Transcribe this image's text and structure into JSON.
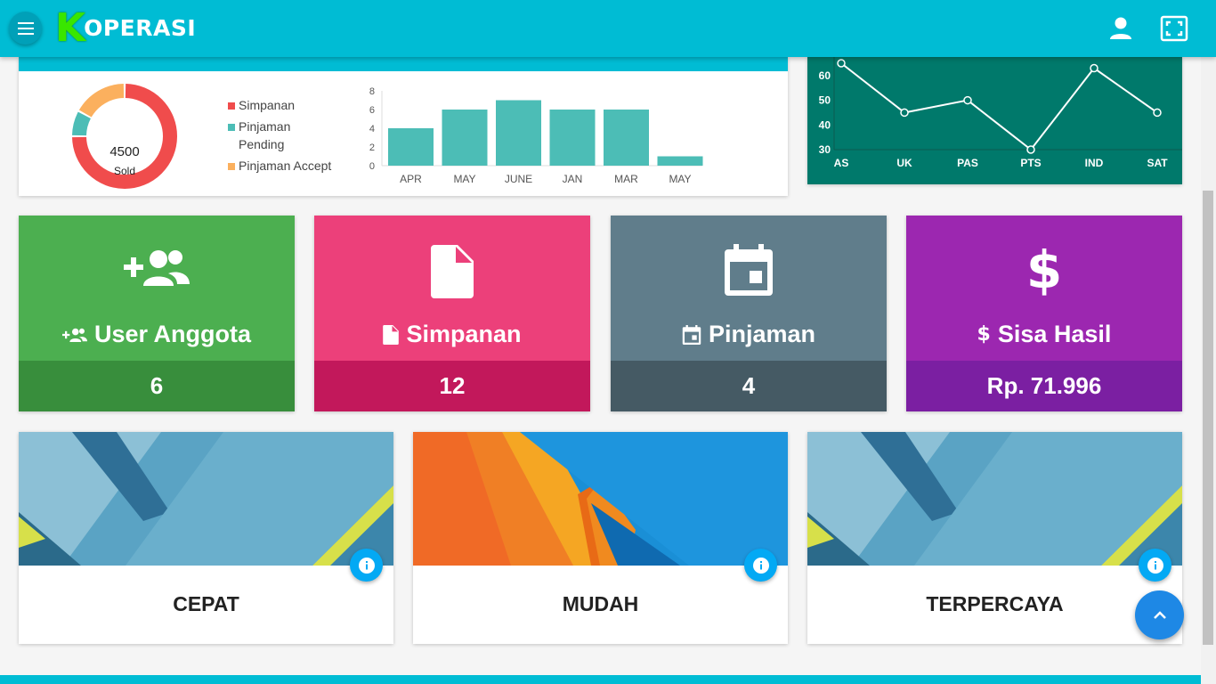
{
  "header": {
    "logo_initial": "K",
    "logo_rest": "OPERASI",
    "menu_icon": "menu-icon",
    "user_icon": "account-icon",
    "fullscreen_icon": "fullscreen-icon"
  },
  "donut": {
    "center_value": "4500",
    "center_label": "Sold"
  },
  "legend": [
    {
      "label": "Simpanan",
      "color": "#f04c4c"
    },
    {
      "label": "Pinjaman Pending",
      "color": "#4cbdb6"
    },
    {
      "label": "Pinjaman Accept",
      "color": "#fbb05e"
    }
  ],
  "chart_data": [
    {
      "type": "pie",
      "categories": [
        "Simpanan",
        "Pinjaman Pending",
        "Pinjaman Accept"
      ],
      "values": [
        75,
        8,
        17
      ],
      "center_text": "4500",
      "center_subtext": "Sold"
    },
    {
      "type": "bar",
      "categories": [
        "APR",
        "MAY",
        "JUNE",
        "JAN",
        "MAR",
        "MAY"
      ],
      "values": [
        4,
        6,
        7,
        6,
        6,
        1
      ],
      "ylim": [
        0,
        8
      ],
      "yticks": [
        0,
        2,
        4,
        6,
        8
      ],
      "color": "#4cbdb6"
    },
    {
      "type": "line",
      "categories": [
        "AS",
        "UK",
        "PAS",
        "PTS",
        "IND",
        "SAT"
      ],
      "values": [
        65,
        45,
        50,
        30,
        63,
        45
      ],
      "ylim": [
        30,
        65
      ],
      "yticks": [
        30,
        40,
        50,
        60
      ],
      "color": "#ffffff",
      "background": "#00796b"
    }
  ],
  "tiles": [
    {
      "label": "User Anggota",
      "value": "6",
      "icon": "group-add-icon",
      "color_top": "#4caf50",
      "color_bottom": "#388e3c"
    },
    {
      "label": "Simpanan",
      "value": "12",
      "icon": "file-icon",
      "color_top": "#ec407a",
      "color_bottom": "#c2185b"
    },
    {
      "label": "Pinjaman",
      "value": "4",
      "icon": "calendar-icon",
      "color_top": "#607d8b",
      "color_bottom": "#455a64"
    },
    {
      "label": "Sisa Hasil",
      "value": "Rp. 71.996",
      "icon": "dollar-icon",
      "color_top": "#9c27b0",
      "color_bottom": "#7b1fa2"
    }
  ],
  "features": [
    {
      "title": "CEPAT",
      "icon": "info-icon"
    },
    {
      "title": "MUDAH",
      "icon": "info-icon"
    },
    {
      "title": "TERPERCAYA",
      "icon": "info-icon"
    }
  ],
  "scroll_top_icon": "chevron-up-icon"
}
